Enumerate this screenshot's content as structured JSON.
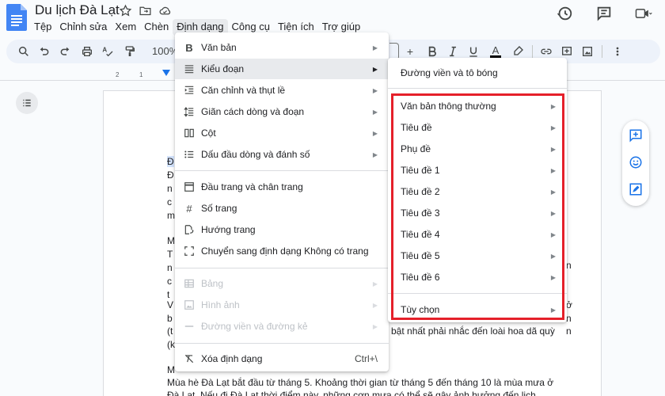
{
  "app": {
    "title": "Du lịch Đà Lạt",
    "menus": [
      "Tệp",
      "Chỉnh sửa",
      "Xem",
      "Chèn",
      "Định dạng",
      "Công cụ",
      "Tiện ích",
      "Trợ giúp"
    ],
    "active_menu_index": 4
  },
  "toolbar": {
    "zoom": "100%",
    "text_color_glyph": "A"
  },
  "ruler": {
    "ticks": [
      "2",
      "1"
    ]
  },
  "document": {
    "lines_left": [
      "Đ",
      "Đ",
      "n",
      "c",
      "m",
      "M",
      "T",
      "n",
      "c",
      "t",
      "V",
      "b",
      "(t",
      "(k",
      "M"
    ],
    "right_fragments": [
      "n",
      "ở",
      "n",
      "n"
    ],
    "partial_line": "bật nhất phải nhắc đến loài hoa dã quỳ",
    "bottom_line_1": "Mùa hè Đà Lạt bắt đầu từ tháng 5. Khoảng thời gian từ tháng 5 đến tháng 10 là mùa mưa ở",
    "bottom_line_2": "Đà Lạt. Nếu đi Đà Lạt thời điểm này, những cơn mưa có thể sẽ gây ảnh hưởng đến lịch"
  },
  "format_menu": {
    "items": [
      {
        "label": "Văn bản",
        "icon": "bold-icon",
        "submenu": true
      },
      {
        "label": "Kiểu đoạn",
        "icon": "paragraph-style-icon",
        "submenu": true,
        "highlighted": true
      },
      {
        "label": "Căn chỉnh và thụt lề",
        "icon": "indent-icon",
        "submenu": true
      },
      {
        "label": "Giãn cách dòng và đoạn",
        "icon": "line-spacing-icon",
        "submenu": true
      },
      {
        "label": "Cột",
        "icon": "columns-icon",
        "submenu": true
      },
      {
        "label": "Dấu đầu dòng và đánh số",
        "icon": "bullet-list-icon",
        "submenu": true
      },
      {
        "label": "Đầu trang và chân trang",
        "icon": "header-footer-icon"
      },
      {
        "label": "Số trang",
        "icon": "hash-icon"
      },
      {
        "label": "Hướng trang",
        "icon": "page-orientation-icon"
      },
      {
        "label": "Chuyển sang định dạng Không có trang",
        "icon": "pageless-icon"
      },
      {
        "label": "Bảng",
        "icon": "table-icon",
        "submenu": true,
        "disabled": true
      },
      {
        "label": "Hình ảnh",
        "icon": "image-icon",
        "submenu": true,
        "disabled": true
      },
      {
        "label": "Đường viền và đường kẻ",
        "icon": "border-line-icon",
        "submenu": true,
        "disabled": true
      },
      {
        "label": "Xóa định dạng",
        "icon": "clear-format-icon",
        "shortcut": "Ctrl+\\"
      }
    ]
  },
  "paragraph_submenu": {
    "top_item": "Đường viền và tô bóng",
    "styles": [
      "Văn bản thông thường",
      "Tiêu đề",
      "Phụ đề",
      "Tiêu đề 1",
      "Tiêu đề 2",
      "Tiêu đề 3",
      "Tiêu đề 4",
      "Tiêu đề 5",
      "Tiêu đề 6"
    ],
    "options": "Tùy chọn"
  },
  "colors": {
    "accent": "#1a73e8",
    "highlight_box": "#e5202a",
    "logo": "#4285f4"
  }
}
